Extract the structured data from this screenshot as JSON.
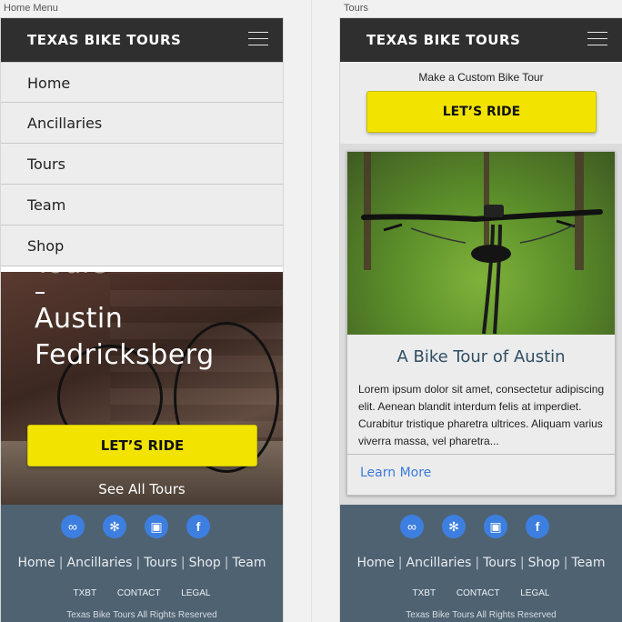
{
  "artboards": [
    {
      "label": "Home Menu"
    },
    {
      "label": "Tours"
    }
  ],
  "header": {
    "brand": "TEXAS BIKE TOURS"
  },
  "menu": {
    "items": [
      "Home",
      "Ancillaries",
      "Tours",
      "Team",
      "Shop"
    ]
  },
  "hero": {
    "partial_text": "Tours",
    "line1": "Austin",
    "line2": "Fedricksberg",
    "cta": "LET’S RIDE",
    "see_all": "See All Tours"
  },
  "tours_page": {
    "custom_label": "Make a Custom Bike Tour",
    "cta": "LET’S RIDE",
    "card": {
      "title": "A Bike Tour of Austin",
      "body": "Lorem ipsum dolor sit amet, consectetur adipiscing elit. Aenean blandit interdum felis at imperdiet. Curabitur tristique pharetra ultrices. Aliquam varius viverra massa, vel pharetra...",
      "link": "Learn More"
    }
  },
  "footer": {
    "social_icons": [
      "tripadvisor-icon",
      "yelp-icon",
      "instagram-icon",
      "facebook-icon"
    ],
    "social_glyphs": [
      "∞",
      "✻",
      "▣",
      "f"
    ],
    "nav": [
      "Home",
      "Ancillaries",
      "Tours",
      "Shop",
      "Team"
    ],
    "small_links": [
      "TXBT",
      "CONTACT",
      "LEGAL"
    ],
    "copyright": "Texas Bike Tours All Rights Reserved"
  },
  "colors": {
    "header": "#2f2f2f",
    "cta_yellow": "#f2e400",
    "footer": "#4f6272",
    "social_blue": "#3d7fe0",
    "link_blue": "#3b7bd8",
    "card_title": "#2f4d63"
  }
}
